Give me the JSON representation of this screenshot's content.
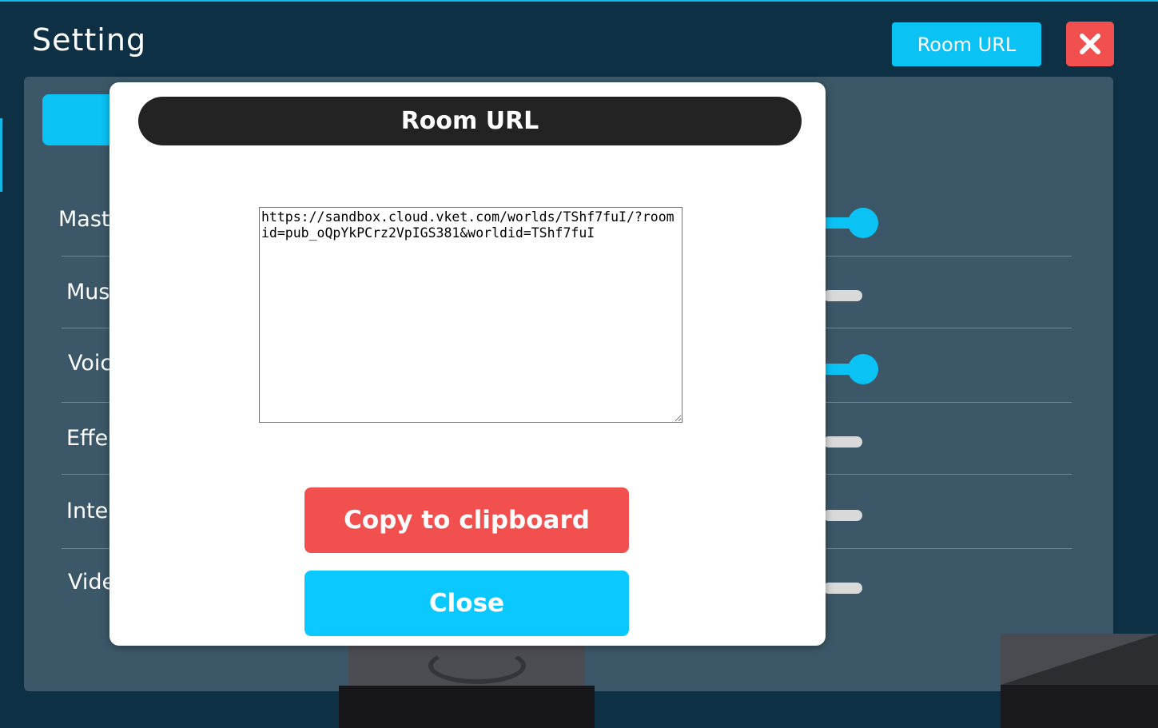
{
  "header": {
    "title": "Setting",
    "room_url_button": "Room URL",
    "close_icon": "close-x-icon"
  },
  "settings_rows": [
    {
      "label": "Mast",
      "level": 0.9,
      "knob": true
    },
    {
      "label": "Mus",
      "level": 0.0,
      "knob": false
    },
    {
      "label": "Voic",
      "level": 0.9,
      "knob": true
    },
    {
      "label": "Effe",
      "level": 0.0,
      "knob": false
    },
    {
      "label": "Inte",
      "level": 0.0,
      "knob": false
    },
    {
      "label": "Vide",
      "level": 0.0,
      "knob": false
    }
  ],
  "modal": {
    "title": "Room URL",
    "url_value": "https://sandbox.cloud.vket.com/worlds/TShf7fuI/?roomid=pub_oQpYkPCrz2VpIGS381&worldid=TShf7fuI",
    "copy_button": "Copy to clipboard",
    "close_button": "Close"
  },
  "colors": {
    "accent": "#0bc2f5",
    "danger": "#f24f4f",
    "background": "#0d3044",
    "panel": "#3c5868"
  }
}
